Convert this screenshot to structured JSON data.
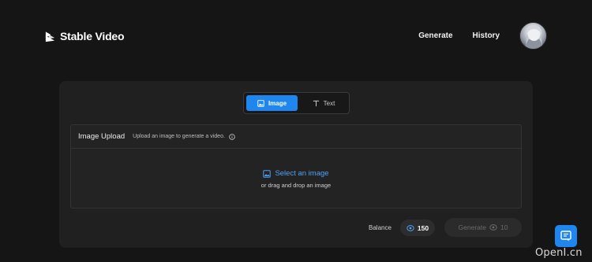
{
  "header": {
    "brand": "Stable Video",
    "nav": {
      "generate": "Generate",
      "history": "History"
    }
  },
  "tabs": {
    "image": "Image",
    "text": "Text"
  },
  "upload": {
    "title": "Image Upload",
    "description": "Upload an image to generate a video.",
    "select_label": "Select an image",
    "drag_label": "or drag and drop an image"
  },
  "footer": {
    "balance_label": "Balance",
    "balance_value": "150",
    "generate_label": "Generate",
    "generate_cost": "10"
  },
  "watermark": "OpenI.cn",
  "colors": {
    "accent": "#1f86f0",
    "link": "#4ea1f7",
    "background": "#151515",
    "card": "#202020"
  },
  "icons": {
    "logo": "play-stack-icon",
    "tab_image": "image-icon",
    "tab_text": "text-icon",
    "info": "info-icon",
    "select": "image-icon",
    "credits": "coin-icon",
    "fab": "chat-icon"
  }
}
